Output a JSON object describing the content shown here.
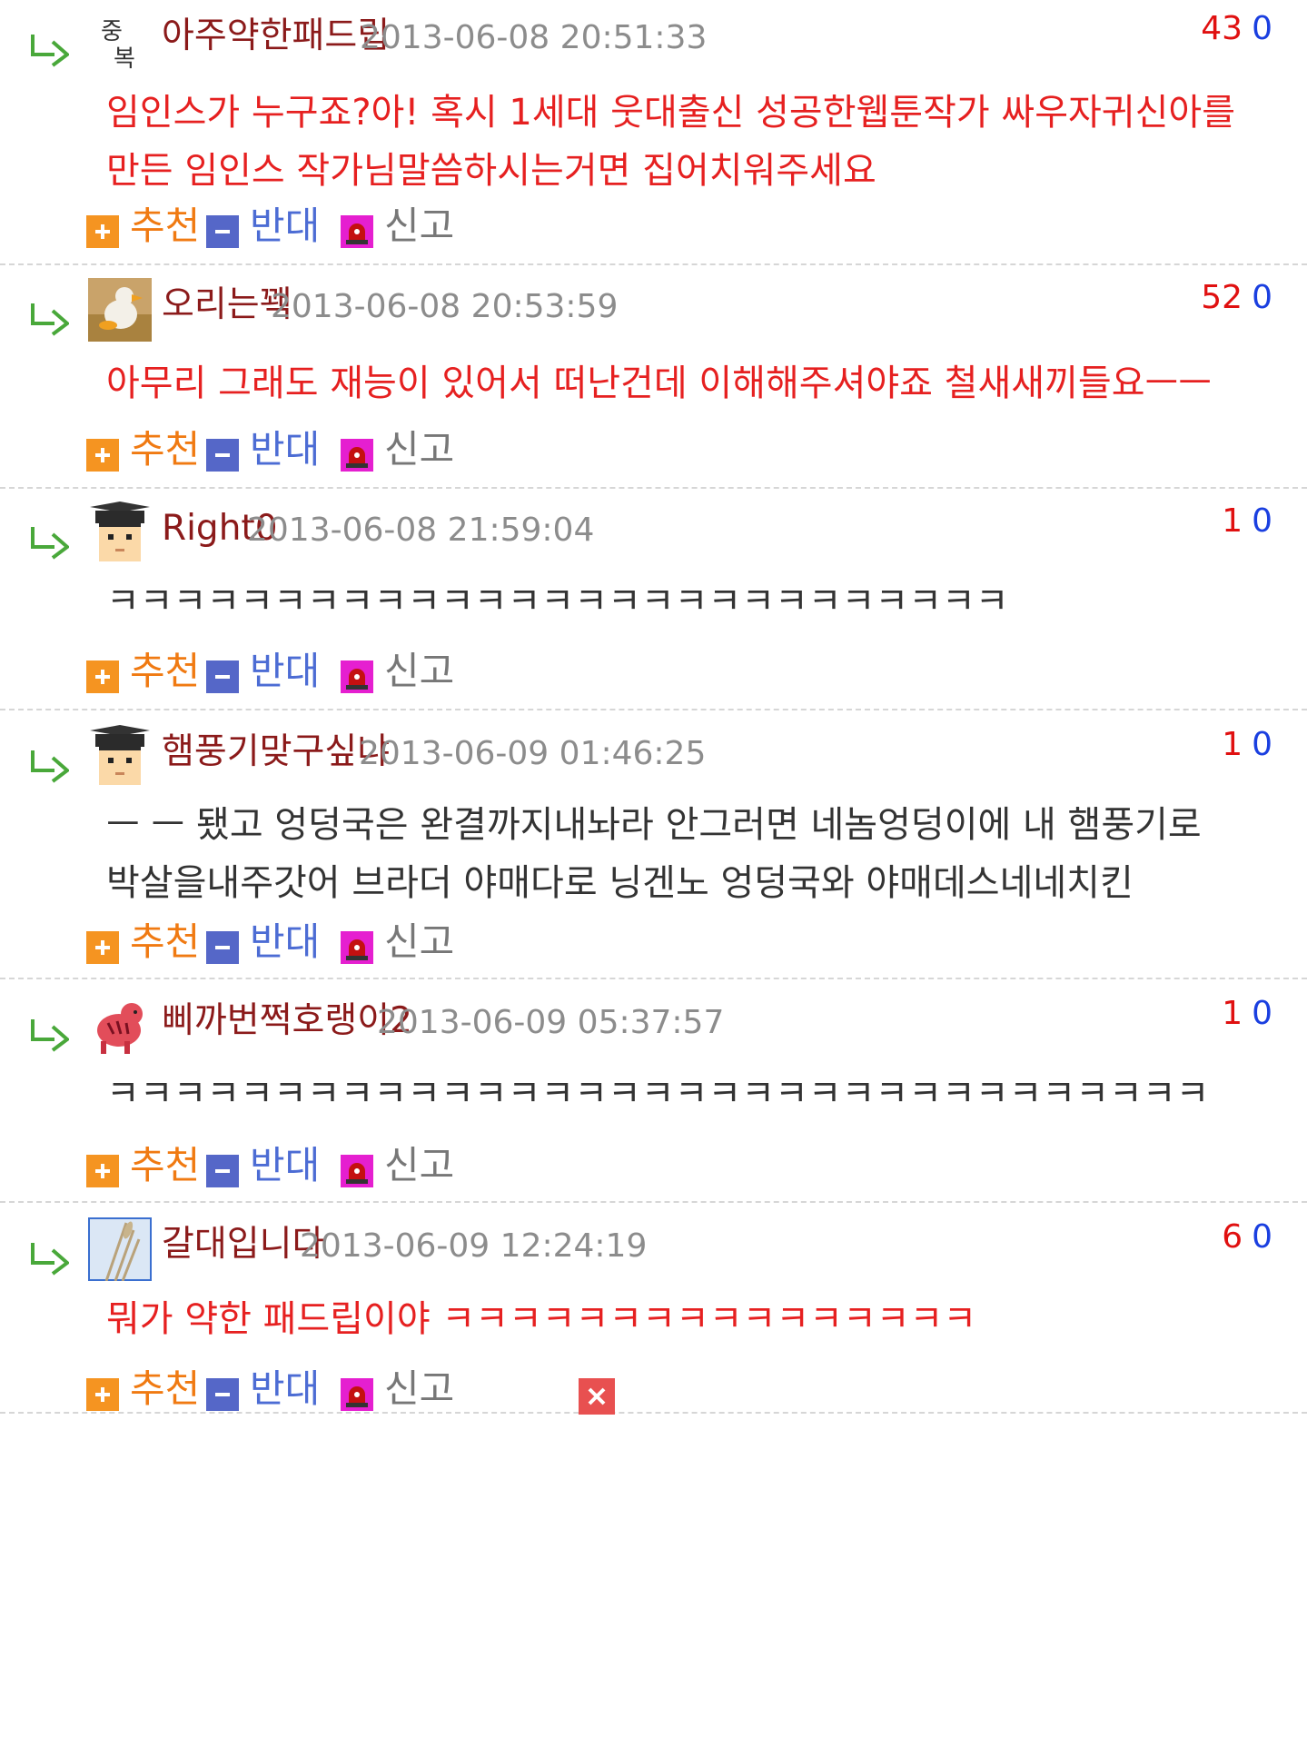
{
  "comments": [
    {
      "nickname": "아주약한패드립",
      "avatar": "text-badge-icon",
      "avatar_text": [
        "중",
        "복"
      ],
      "date": "2013-06-08 20:51:33",
      "votes_up": "43",
      "votes_down": "0",
      "body": "임인스가 누구죠?아! 혹시 1세대 웃대출신 성공한웹툰작가 싸우자귀신아를\n만든 임인스 작가님말씀하시는거면 집어치워주세요",
      "body_color": "red"
    },
    {
      "nickname": "오리는꽥",
      "avatar": "duck-photo-icon",
      "date": "2013-06-08 20:53:59",
      "votes_up": "52",
      "votes_down": "0",
      "body": "아무리 그래도 재능이 있어서 떠난건데 이해해주셔야죠 철새새끼들요ㅡㅡ",
      "body_color": "red"
    },
    {
      "nickname": "Right0",
      "avatar": "graduate-cap-icon",
      "date": "2013-06-08 21:59:04",
      "votes_up": "1",
      "votes_down": "0",
      "body": "ㅋㅋㅋㅋㅋㅋㅋㅋㅋㅋㅋㅋㅋㅋㅋㅋㅋㅋㅋㅋㅋㅋㅋㅋㅋㅋㅋ",
      "body_color": "dark"
    },
    {
      "nickname": "햄풍기맞구싶냐",
      "avatar": "graduate-cap-icon",
      "date": "2013-06-09 01:46:25",
      "votes_up": "1",
      "votes_down": "0",
      "body": "ㅡ ㅡ 됐고 엉덩국은 완결까지내놔라 안그러면 네놈엉덩이에 내 햄풍기로\n박살을내주갓어 브라더 야매다로 닝겐노 엉덩국와 야매데스네네치킨",
      "body_color": "dark"
    },
    {
      "nickname": "삐까번쩍호랭이2",
      "avatar": "red-tiger-icon",
      "date": "2013-06-09 05:37:57",
      "votes_up": "1",
      "votes_down": "0",
      "body": "ㅋㅋㅋㅋㅋㅋㅋㅋㅋㅋㅋㅋㅋㅋㅋㅋㅋㅋㅋㅋㅋㅋㅋㅋㅋㅋㅋㅋㅋㅋㅋㅋㅋ",
      "body_color": "dark"
    },
    {
      "nickname": "갈대입니다",
      "avatar": "reed-photo-icon",
      "date": "2013-06-09 12:24:19",
      "votes_up": "6",
      "votes_down": "0",
      "body": "뭐가 약한 패드립이야 ㅋㅋㅋㅋㅋㅋㅋㅋㅋㅋㅋㅋㅋㅋㅋㅋ",
      "body_color": "red",
      "has_delete": true
    }
  ],
  "actions": {
    "recommend": "추천",
    "oppose": "반대",
    "report": "신고"
  },
  "colors": {
    "nickname": "#8b1a1a",
    "date": "#8c8c8c",
    "votes_up": "#e01010",
    "votes_down": "#1a3fe0",
    "body_red": "#e62020",
    "body_dark": "#333333",
    "recommend": "#f07a12",
    "oppose": "#4c6cd4",
    "report": "#777777"
  }
}
